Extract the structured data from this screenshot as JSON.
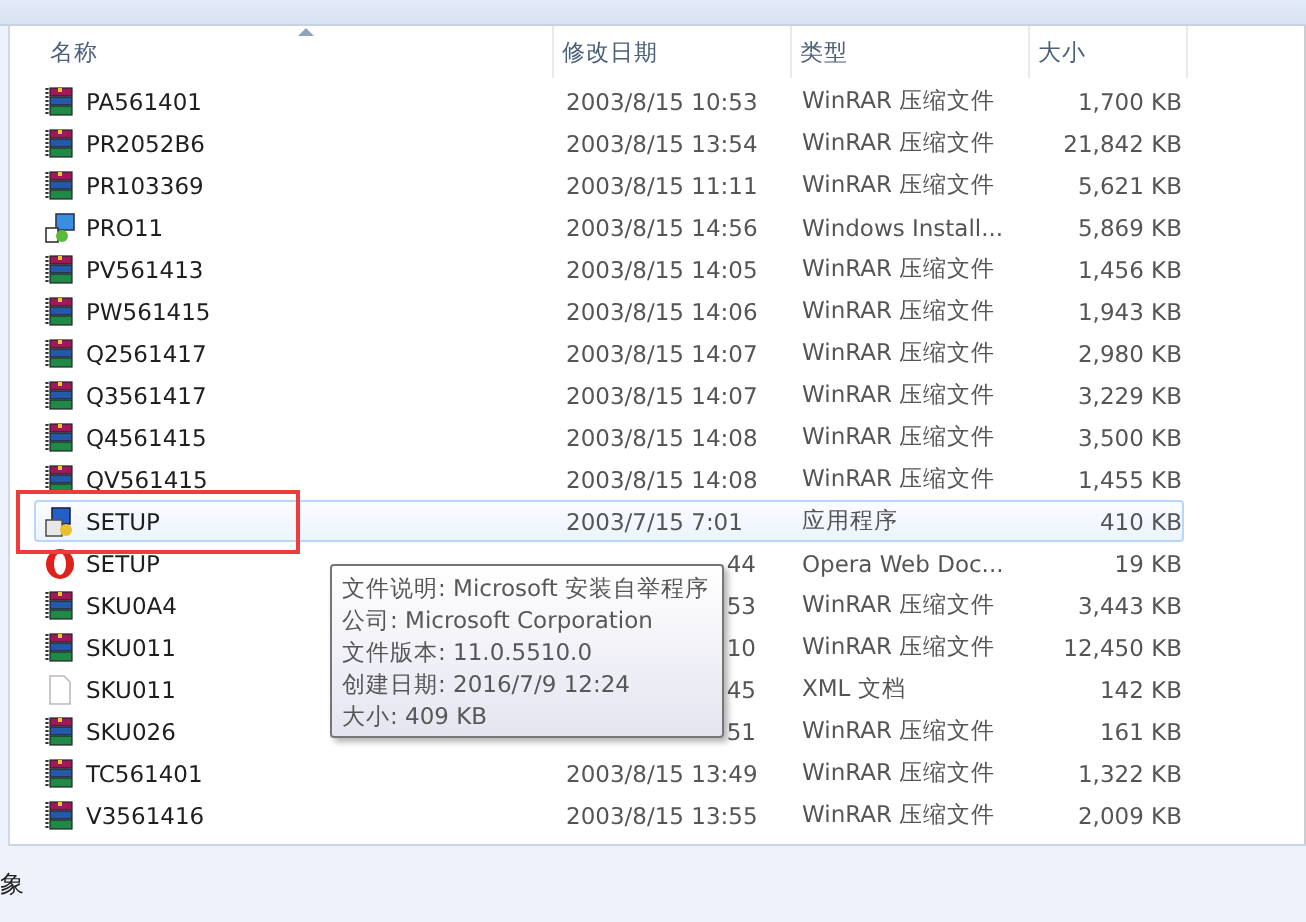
{
  "columns": [
    {
      "label": "名称",
      "sorted": true
    },
    {
      "label": "修改日期",
      "sorted": false
    },
    {
      "label": "类型",
      "sorted": false
    },
    {
      "label": "大小",
      "sorted": false
    }
  ],
  "rows": [
    {
      "kind": "archive",
      "name": "PA561401",
      "date": "2003/8/15 10:53",
      "type": "WinRAR 压缩文件",
      "size": "1,700 KB",
      "hovered": false
    },
    {
      "kind": "archive",
      "name": "PR2052B6",
      "date": "2003/8/15 13:54",
      "type": "WinRAR 压缩文件",
      "size": "21,842 KB",
      "hovered": false
    },
    {
      "kind": "archive",
      "name": "PR103369",
      "date": "2003/8/15 11:11",
      "type": "WinRAR 压缩文件",
      "size": "5,621 KB",
      "hovered": false
    },
    {
      "kind": "installer",
      "name": "PRO11",
      "date": "2003/8/15 14:56",
      "type": "Windows Install...",
      "size": "5,869 KB",
      "hovered": false
    },
    {
      "kind": "archive",
      "name": "PV561413",
      "date": "2003/8/15 14:05",
      "type": "WinRAR 压缩文件",
      "size": "1,456 KB",
      "hovered": false
    },
    {
      "kind": "archive",
      "name": "PW561415",
      "date": "2003/8/15 14:06",
      "type": "WinRAR 压缩文件",
      "size": "1,943 KB",
      "hovered": false
    },
    {
      "kind": "archive",
      "name": "Q2561417",
      "date": "2003/8/15 14:07",
      "type": "WinRAR 压缩文件",
      "size": "2,980 KB",
      "hovered": false
    },
    {
      "kind": "archive",
      "name": "Q3561417",
      "date": "2003/8/15 14:07",
      "type": "WinRAR 压缩文件",
      "size": "3,229 KB",
      "hovered": false
    },
    {
      "kind": "archive",
      "name": "Q4561415",
      "date": "2003/8/15 14:08",
      "type": "WinRAR 压缩文件",
      "size": "3,500 KB",
      "hovered": false
    },
    {
      "kind": "archive",
      "name": "QV561415",
      "date": "2003/8/15 14:08",
      "type": "WinRAR 压缩文件",
      "size": "1,455 KB",
      "hovered": false
    },
    {
      "kind": "setup",
      "name": "SETUP",
      "date": "2003/7/15 7:01",
      "type": "应用程序",
      "size": "410 KB",
      "hovered": true,
      "framed": true
    },
    {
      "kind": "opera",
      "name": "SETUP",
      "date_visible_end": "44",
      "type": "Opera Web Doc...",
      "size": "19 KB",
      "hovered": false
    },
    {
      "kind": "archive",
      "name": "SKU0A4",
      "date_visible_end": "53",
      "type": "WinRAR 压缩文件",
      "size": "3,443 KB",
      "hovered": false
    },
    {
      "kind": "archive",
      "name": "SKU011",
      "date_visible_end": "10",
      "type": "WinRAR 压缩文件",
      "size": "12,450 KB",
      "hovered": false
    },
    {
      "kind": "document",
      "name": "SKU011",
      "date_visible_end": "45",
      "type": "XML 文档",
      "size": "142 KB",
      "hovered": false
    },
    {
      "kind": "archive",
      "name": "SKU026",
      "date_visible_end": "51",
      "type": "WinRAR 压缩文件",
      "size": "161 KB",
      "hovered": false
    },
    {
      "kind": "archive",
      "name": "TC561401",
      "date": "2003/8/15 13:49",
      "type": "WinRAR 压缩文件",
      "size": "1,322 KB",
      "hovered": false
    },
    {
      "kind": "archive",
      "name": "V3561416",
      "date": "2003/8/15 13:55",
      "type": "WinRAR 压缩文件",
      "size": "2,009 KB",
      "hovered": false
    }
  ],
  "tooltip": [
    "文件说明: Microsoft 安装自举程序",
    "公司: Microsoft Corporation",
    "文件版本: 11.0.5510.0",
    "创建日期: 2016/7/9 12:24",
    "大小: 409 KB"
  ],
  "status_bar": {
    "text": "象"
  }
}
